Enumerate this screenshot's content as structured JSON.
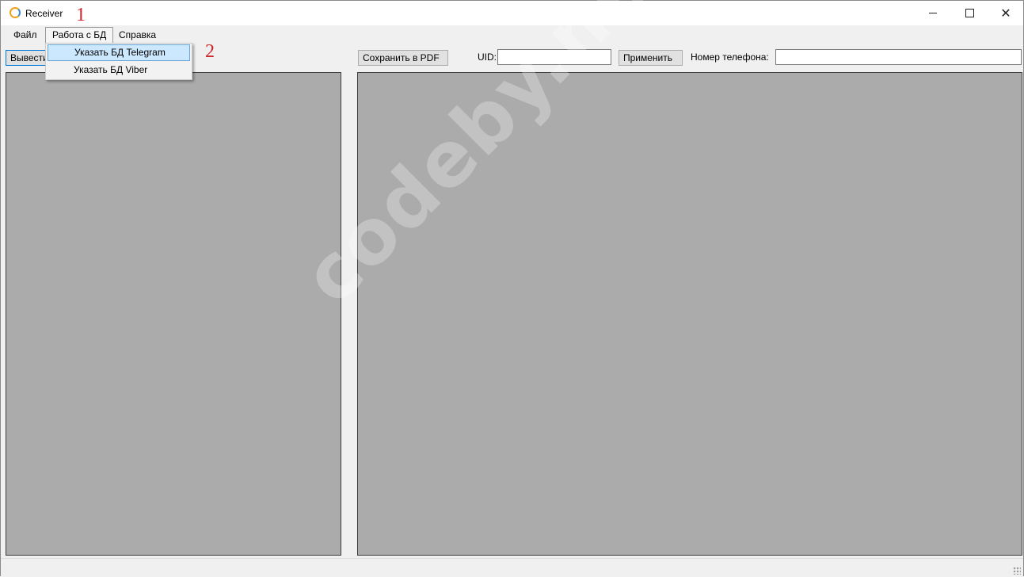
{
  "window": {
    "title": "Receiver",
    "annotation_1": "1",
    "annotation_2": "2"
  },
  "menubar": {
    "file": "Файл",
    "database": "Работа с БД",
    "help": "Справка"
  },
  "dropdown": {
    "items": [
      {
        "label": "Указать БД Telegram"
      },
      {
        "label": "Указать БД Viber"
      }
    ]
  },
  "toolbar": {
    "export_label": "Вывести",
    "save_pdf_label": "Сохранить в PDF",
    "uid_label": "UID:",
    "uid_value": "",
    "apply_label": "Применить",
    "phone_label": "Номер телефона:",
    "phone_value": ""
  },
  "watermark": "codeby.net",
  "colors": {
    "panel": "#ababab",
    "highlight": "#cce8ff",
    "annotation": "#d0252b"
  }
}
